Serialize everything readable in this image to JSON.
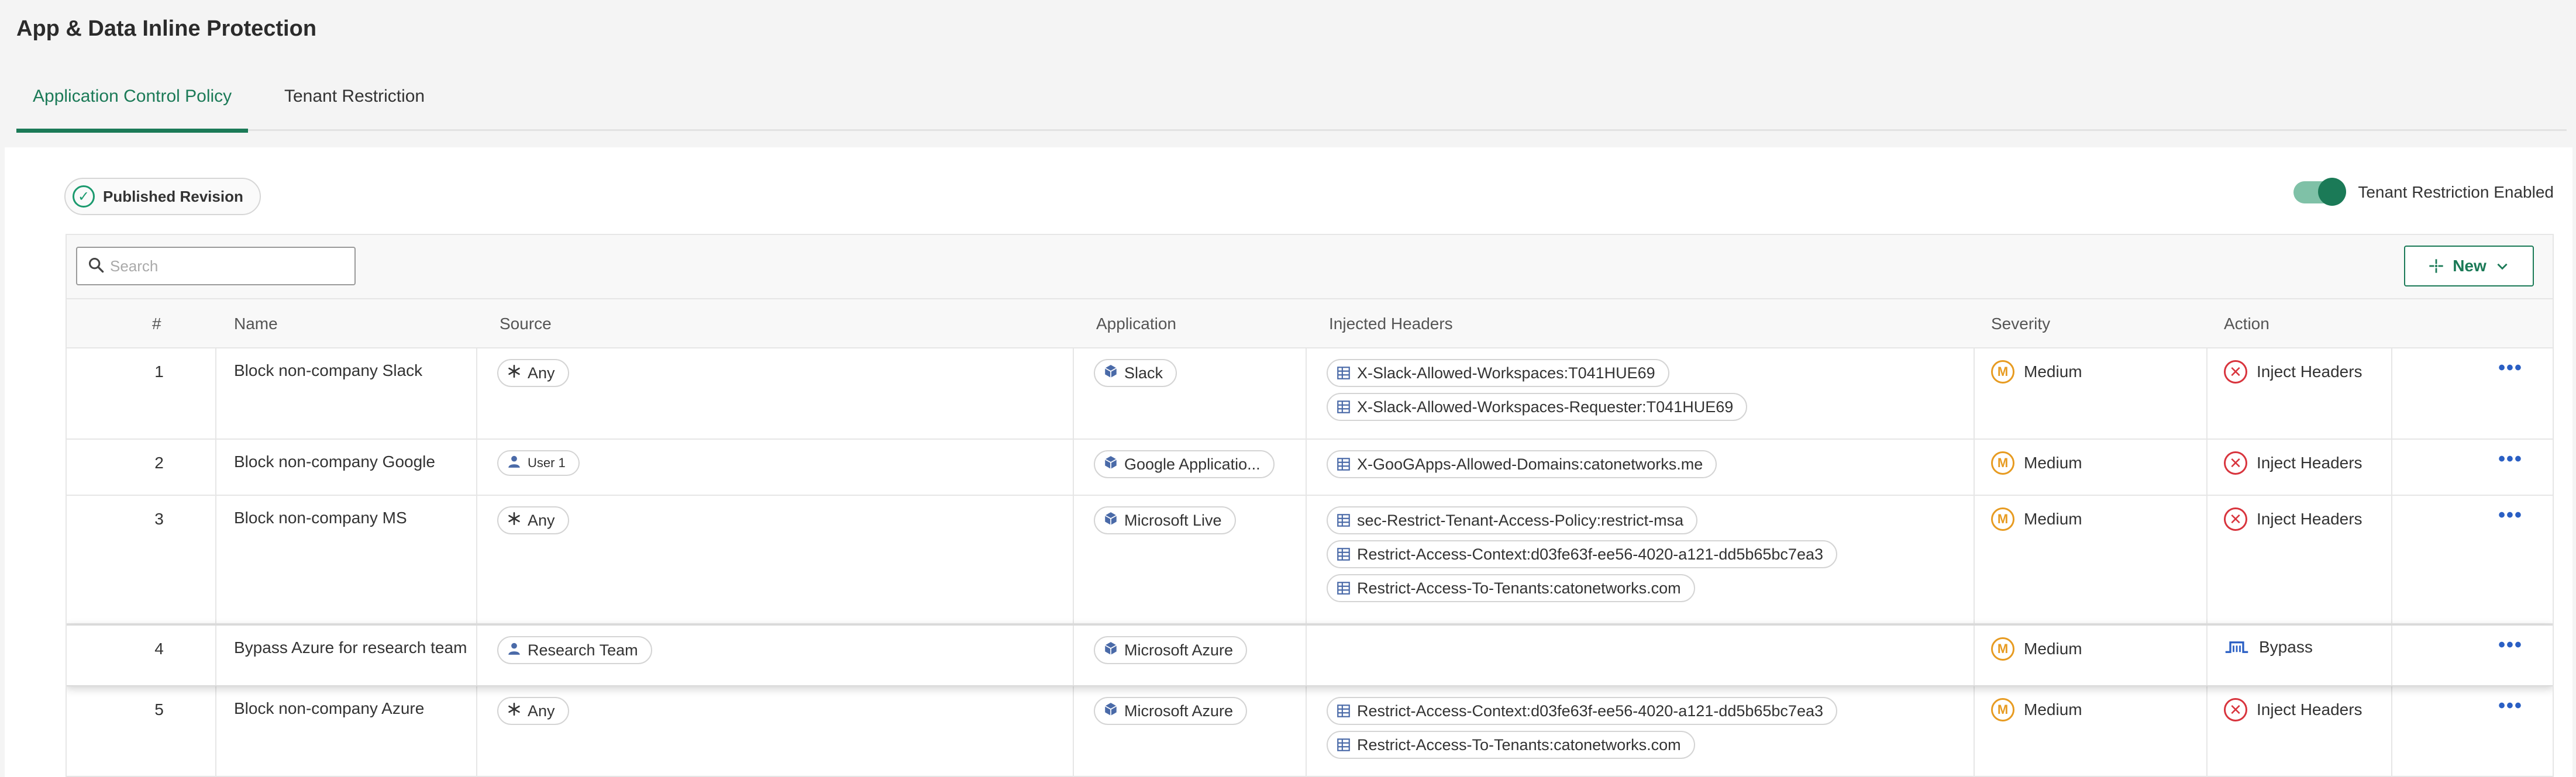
{
  "page": {
    "title": "App & Data Inline Protection"
  },
  "tabs": [
    {
      "label": "Application Control Policy",
      "active": true
    },
    {
      "label": "Tenant Restriction",
      "active": false
    }
  ],
  "revision": {
    "label": "Published Revision",
    "icon": "check-circle-icon"
  },
  "tenant_toggle": {
    "label": "Tenant Restriction Enabled",
    "enabled": true
  },
  "search": {
    "placeholder": "Search",
    "value": ""
  },
  "toolbar": {
    "new_label": "New"
  },
  "columns": {
    "num": "#",
    "name": "Name",
    "source": "Source",
    "application": "Application",
    "headers": "Injected Headers",
    "severity": "Severity",
    "action": "Action"
  },
  "rows": [
    {
      "num": "1",
      "name": "Block non-company Slack",
      "source": "Any",
      "source_icon": "asterisk-icon",
      "application": "Slack",
      "headers": [
        "X-Slack-Allowed-Workspaces:T041HUE69",
        "X-Slack-Allowed-Workspaces-Requester:T041HUE69"
      ],
      "severity": "Medium",
      "action": "Inject Headers"
    },
    {
      "num": "2",
      "name": "Block non-company Google",
      "source": "User 1",
      "source_icon": "user-icon",
      "application": "Google Applicatio...",
      "headers": [
        "X-GooGApps-Allowed-Domains:catonetworks.me"
      ],
      "severity": "Medium",
      "action": "Inject Headers"
    },
    {
      "num": "3",
      "name": "Block non-company MS",
      "source": "Any",
      "source_icon": "asterisk-icon",
      "application": "Microsoft Live",
      "headers": [
        "sec-Restrict-Tenant-Access-Policy:restrict-msa",
        "Restrict-Access-Context:d03fe63f-ee56-4020-a121-dd5b65bc7ea3",
        "Restrict-Access-To-Tenants:catonetworks.com"
      ],
      "severity": "Medium",
      "action": "Inject Headers"
    },
    {
      "num": "4",
      "name": "Bypass Azure for research team",
      "source": "Research Team",
      "source_icon": "user-icon",
      "application": "Microsoft Azure",
      "headers": [],
      "severity": "Medium",
      "action": "Bypass"
    },
    {
      "num": "5",
      "name": "Block non-company Azure",
      "source": "Any",
      "source_icon": "asterisk-icon",
      "application": "Microsoft Azure",
      "headers": [
        "Restrict-Access-Context:d03fe63f-ee56-4020-a121-dd5b65bc7ea3",
        "Restrict-Access-To-Tenants:catonetworks.com"
      ],
      "severity": "Medium",
      "action": "Inject Headers"
    }
  ],
  "colors": {
    "accent": "#1b7a57",
    "severity_medium": "#e79b21",
    "action_block": "#d8343d",
    "link": "#2a5fc4"
  }
}
